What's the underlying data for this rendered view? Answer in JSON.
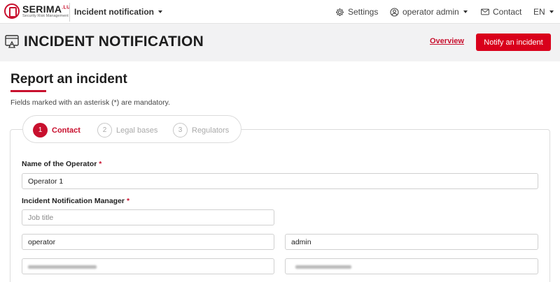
{
  "nav": {
    "logo_name": "SERIMA",
    "logo_sup": ".LU",
    "logo_sub": "Security Risk Management",
    "module": "Incident notification",
    "settings": "Settings",
    "user": "operator admin",
    "contact": "Contact",
    "language": "EN"
  },
  "header": {
    "title": "INCIDENT NOTIFICATION",
    "overview_link": "Overview",
    "notify_button": "Notify an incident"
  },
  "section": {
    "title": "Report an incident",
    "note": "Fields marked with an asterisk (*) are mandatory."
  },
  "steps": [
    {
      "num": "1",
      "label": "Contact",
      "state": "active"
    },
    {
      "num": "2",
      "label": "Legal bases",
      "state": "inactive"
    },
    {
      "num": "3",
      "label": "Regulators",
      "state": "inactive"
    }
  ],
  "form": {
    "operator_label": "Name of the Operator",
    "operator_value": "Operator 1",
    "manager_label": "Incident Notification Manager",
    "job_title_placeholder": "Job title",
    "first_name_value": "operator",
    "last_name_value": "admin",
    "required_mark": "*"
  },
  "colors": {
    "accent": "#c8102e",
    "button": "#d9001b",
    "header_band": "#f2f2f3"
  }
}
